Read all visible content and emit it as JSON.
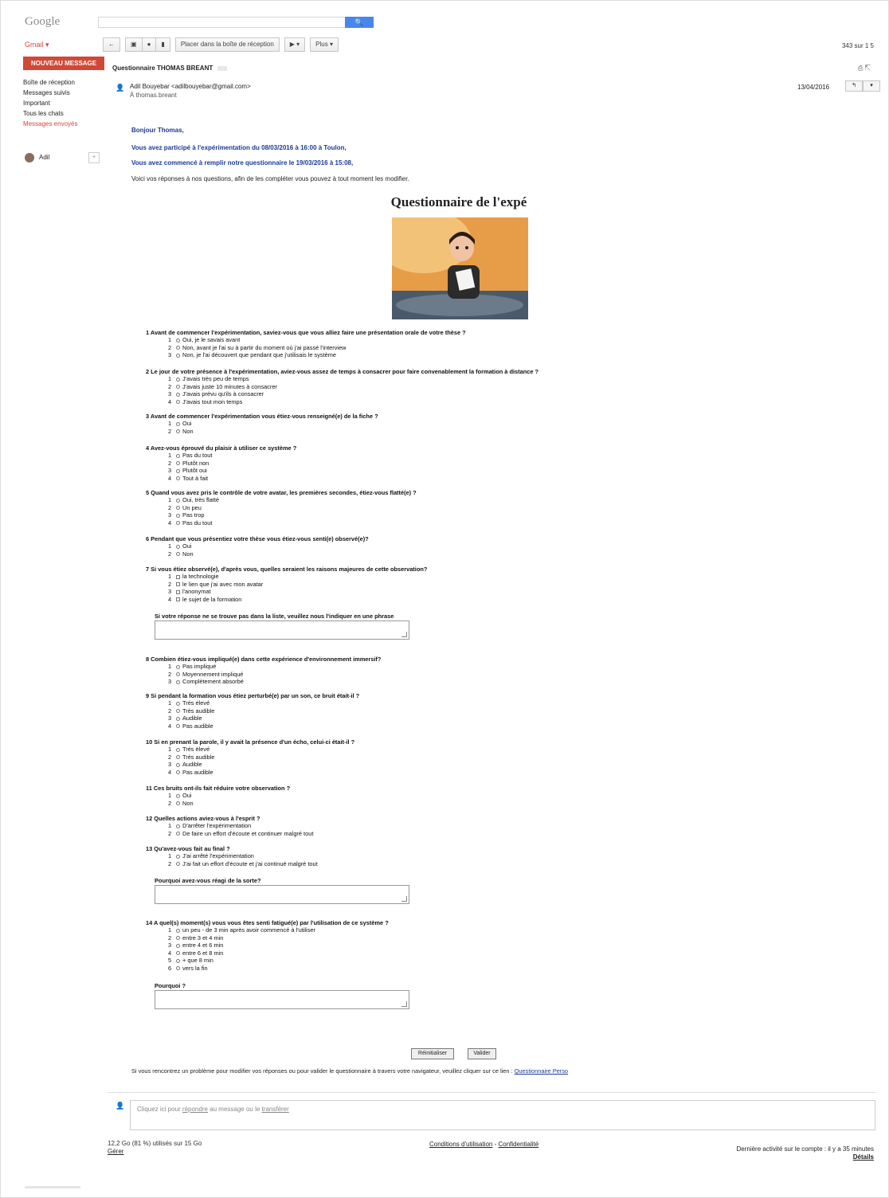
{
  "header": {
    "logo": "Google",
    "search_button": "🔍",
    "gmail_label": "Gmail ▾",
    "page_count": "343 sur 1 5"
  },
  "toolbar": {
    "back": "←",
    "archive": "▣",
    "spam": "●",
    "delete": "▮",
    "move": "Placer dans la boîte de réception",
    "labels": "▶ ▾",
    "more": "Plus ▾"
  },
  "compose_label": "NOUVEAU MESSAGE",
  "sidebar": {
    "items": [
      {
        "label": "Boîte de réception"
      },
      {
        "label": "Messages suivis"
      },
      {
        "label": "Important"
      },
      {
        "label": "Tous les chats"
      },
      {
        "label": "Messages envoyés"
      }
    ],
    "chat_user": "Adil",
    "chat_btn": "+"
  },
  "email": {
    "subject": "Questionnaire THOMAS BREANT",
    "print_icon": "⎙ ⇱",
    "sender": "Adil Bouyebar <adilbouyebar@gmail.com>",
    "recipient": "À thomas.breant",
    "date": "13/04/2016",
    "reply": "↰",
    "more": "▾",
    "greeting": "Bonjour Thomas,",
    "line1": "Vous avez participé à l'expérimentation du 08/03/2016 à 16:00 à Toulon,",
    "line2": "Vous avez commencé à remplir notre questionnaire le 19/03/2016 à 15:08,",
    "line3": "Voici vos réponses à nos questions, afin de les compléter vous pouvez à tout moment les modifier."
  },
  "form": {
    "title": "Questionnaire de l'expé",
    "questions": [
      {
        "q": "1   Avant de commencer l'expérimentation, saviez-vous que vous alliez faire une présentation orale de votre thèse ?",
        "options": [
          "Oui, je le savais avant",
          "Non, avant je l'ai su à partir du moment où j'ai passé l'interview",
          "Non, je l'ai découvert que pendant que j'utilisais le système"
        ]
      },
      {
        "q": "2   Le jour de votre présence à l'expérimentation, aviez-vous assez de temps à consacrer pour faire convenablement la formation à distance ?",
        "options": [
          "J'avais très peu de temps",
          "J'avais juste 10 minutes à consacrer",
          "J'avais prévu qu'ils à consacrer",
          "J'avais tout mon temps"
        ]
      },
      {
        "q": "3   Avant de commencer l'expérimentation vous étiez-vous renseigné(e) de la fiche ?",
        "options": [
          "Oui",
          "Non"
        ]
      },
      {
        "q": "4   Avez-vous éprouvé du plaisir à utiliser ce système ?",
        "options": [
          "Pas du tout",
          "Plutôt non",
          "Plutôt oui",
          "Tout à fait"
        ]
      },
      {
        "q": "5   Quand vous avez pris le contrôle de votre avatar, les premières secondes, étiez-vous flatté(e) ?",
        "options": [
          "Oui, très flatté",
          "Un peu",
          "Pas trop",
          "Pas du tout"
        ]
      },
      {
        "q": "6   Pendant que vous présentiez votre thèse vous étiez-vous senti(e) observé(e)?",
        "options": [
          "Oui",
          "Non"
        ]
      },
      {
        "q": "7   Si vous étiez observé(e), d'après vous, quelles seraient les raisons majeures de cette observation?",
        "options": [
          "la technologie",
          "le lien que j'ai avec mon avatar",
          "l'anonymat",
          "le sujet de la formation"
        ]
      },
      {
        "q": "8   Combien étiez-vous impliqué(e) dans cette expérience d'environnement immersif?",
        "options": [
          "Pas impliqué",
          "Moyennement impliqué",
          "Complètement absorbé"
        ]
      },
      {
        "q": "9   Si pendant la formation vous étiez perturbé(e) par un son, ce bruit était-il ?",
        "options": [
          "Très élevé",
          "Très audible",
          "Audible",
          "Pas audible"
        ]
      },
      {
        "q": "10  Si en prenant la parole, il y avait la présence d'un écho, celui-ci était-il ?",
        "options": [
          "Très élevé",
          "Très audible",
          "Audible",
          "Pas audible"
        ]
      },
      {
        "q": "11  Ces bruits ont-ils fait réduire votre observation ?",
        "options": [
          "Oui",
          "Non"
        ]
      },
      {
        "q": "12  Quelles actions aviez-vous à l'esprit ?",
        "options": [
          "D'arrêter l'expérimentation",
          "De faire un effort d'écoute et continuer malgré tout"
        ]
      },
      {
        "q": "13  Qu'avez-vous fait au final ?",
        "options": [
          "J'ai arrêté l'expérimentation",
          "J'ai fait un effort d'écoute et j'ai continué malgré tout"
        ]
      },
      {
        "q": "14  A quel(s) moment(s) vous vous êtes senti fatigué(e) par l'utilisation de ce système ?",
        "options": [
          "un peu - de 3 min après avoir commencé à l'utiliser",
          "entre 3 et 4 min",
          "entre 4 et 6 min",
          "entre 6 et 8 min",
          "+ que 8 min",
          "vers la fin"
        ]
      }
    ],
    "q7_extra": "Si votre réponse ne se trouve pas dans la liste, veuillez nous l'indiquer en une phrase",
    "q13_extra": "Pourquoi avez-vous réagi de la sorte?",
    "q14_extra": "Pourquoi ?",
    "reset": "Réinitialiser",
    "submit": "Valider",
    "footer_text": "Si vous rencontrez un problème pour modifier vos réponses ou pour valider le questionnaire à travers votre navigateur, veuillez cliquer sur ce lien :",
    "footer_link": "Questionnaire Perso"
  },
  "reply": {
    "text_a": "Cliquez ici pour ",
    "link_a": "répondre",
    "text_b": " au message ou le ",
    "link_b": "transférer"
  },
  "footer": {
    "storage": "12,2 Go (81 %) utilisés sur 15 Go",
    "manage": "Gérer",
    "terms": "Conditions d'utilisation",
    "privacy": "Confidentialité",
    "activity": "Dernière activité sur le compte : il y a 35 minutes",
    "details": "Détails"
  }
}
